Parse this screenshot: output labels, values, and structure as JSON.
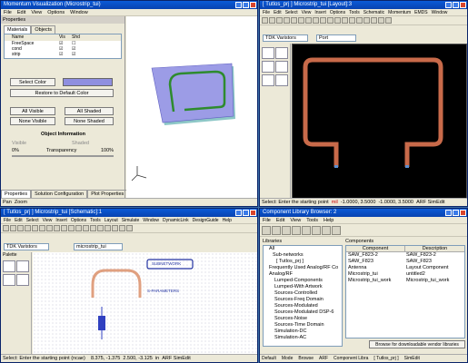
{
  "vis": {
    "title": "Momentum Visualization (Microstrip_tui)",
    "menu": [
      "File",
      "Edit",
      "View",
      "Options",
      "Window"
    ],
    "panel_title": "Properties",
    "tabs": [
      "Materials",
      "Objects"
    ],
    "table_headers": [
      "Name",
      "Vis",
      "Shd"
    ],
    "materials": [
      "FreeSpace",
      "cond",
      "strip"
    ],
    "select_color": "Select Color",
    "restore_color": "Restore to Default Color",
    "all_visible": "All Visible",
    "all_shaded": "All Shaded",
    "none_visible": "None Visible",
    "none_shaded": "None Shaded",
    "obj_info": "Object Information",
    "visible": "Visible",
    "shaded": "Shaded",
    "transparency": "Transparency",
    "t0": "0%",
    "t100": "100%",
    "bottom_tabs": [
      "Properties",
      "Solution Configuration",
      "Plot Properties"
    ],
    "status_pos": "Pan",
    "status_zoom": "Zoom"
  },
  "layout": {
    "title": "[ Tutlos_prj ] Microstrip_tui [Layout]:3",
    "menu": [
      "File",
      "Edit",
      "Select",
      "View",
      "Insert",
      "Options",
      "Tools",
      "Schematic",
      "Momentum",
      "EMDS",
      "Window"
    ],
    "lib_dropdown": "TDK Varistors",
    "layer_dropdown": "Port",
    "status": "Select: Enter the starting point",
    "coords": "-1.0000, 3.5000",
    "coords2": "-1.0000, 3.5000",
    "unit": "mil",
    "sel": "ARF SimEdit"
  },
  "schem": {
    "title": "[ Tutlos_prj ] Microstrip_tui [Schematic]:1",
    "menu": [
      "File",
      "Edit",
      "Select",
      "View",
      "Insert",
      "Options",
      "Tools",
      "Layout",
      "Simulate",
      "Window",
      "DynamicLink",
      "DesignGuide",
      "Help"
    ],
    "lib_dropdown": "TDK Varistors",
    "component_dropdown": "microstrip_tui",
    "palette": "Palette",
    "sub_title": "SUBNETWORK",
    "port_label": "S-PARAMETERS",
    "status": "Select: Enter the starting point (ncae)",
    "coords": "8.375, -1.375",
    "coords2": "2.500, -3.125",
    "unit": "in",
    "sel": "ARF SimEdit"
  },
  "lib": {
    "title": "Component Library Browser: 2",
    "menu": [
      "File",
      "Edit",
      "View",
      "Tools",
      "Help"
    ],
    "libraries_label": "Libraries",
    "components_label": "Components",
    "tree": [
      "All",
      "Sub-networks",
      "[ Tutlos_prj ]",
      "Frequently Used Analog/RF Co",
      "Analog/RF",
      "Lumped-Components",
      "Lumped-With Artwork",
      "Sources-Controlled",
      "Sources-Freq Domain",
      "Sources-Modulated",
      "Sources-Modulated DSP-6",
      "Sources-Noise",
      "Sources-Time Domain",
      "Simulation-DC",
      "Simulation-AC"
    ],
    "col_component": "Component",
    "col_description": "Description",
    "rows": [
      [
        "SAW_F823-2",
        "SAW_F823-2"
      ],
      [
        "SAW_F823",
        "SAW_F823"
      ],
      [
        "Antenna",
        "Layout Component"
      ],
      [
        "Microstrip_tui",
        "untitled2"
      ],
      [
        "Microstrip_tui_work",
        "Microstrip_tui_work"
      ]
    ],
    "browse_hint": "Browse for downloadable vendor libraries",
    "status_default": "Default",
    "status_mode": "Mode",
    "status_browse": "Browse",
    "status_arf": "ARF",
    "status_lib": "Component Libra",
    "status_proj": "[ Tutlos_prj ]",
    "status_edit": "SimEdit"
  },
  "colors": {
    "trace": "#c86a4a",
    "layout_bg": "#000000",
    "title_bar": "#0a5ad8"
  }
}
